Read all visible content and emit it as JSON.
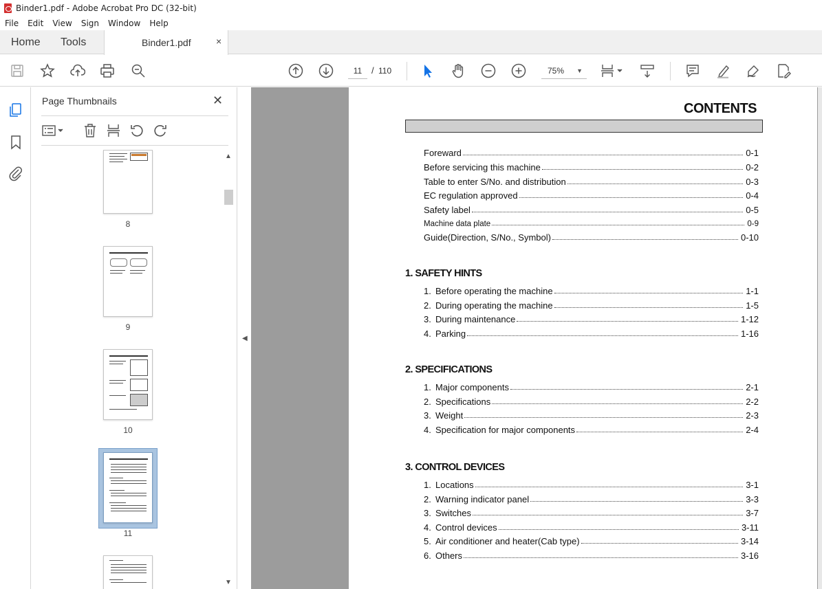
{
  "window": {
    "title": "Binder1.pdf - Adobe Acrobat Pro DC (32-bit)"
  },
  "menu": [
    "File",
    "Edit",
    "View",
    "Sign",
    "Window",
    "Help"
  ],
  "tabs": {
    "home": "Home",
    "tools": "Tools",
    "document": "Binder1.pdf",
    "close": "×"
  },
  "toolbar": {
    "current_page": "11",
    "page_separator": "/",
    "total_pages": "110",
    "zoom": "75%"
  },
  "panel": {
    "title": "Page Thumbnails",
    "thumbnails": [
      {
        "label": "8"
      },
      {
        "label": "9"
      },
      {
        "label": "10"
      },
      {
        "label": "11",
        "selected": true
      },
      {
        "label": ""
      }
    ]
  },
  "document": {
    "title": "CONTENTS",
    "front_matter": [
      {
        "text": "Foreward",
        "page": "0-1"
      },
      {
        "text": "Before servicing this machine",
        "page": "0-2"
      },
      {
        "text": "Table to enter S/No. and distribution",
        "page": "0-3"
      },
      {
        "text": "EC regulation approved",
        "page": "0-4"
      },
      {
        "text": "Safety label",
        "page": "0-5"
      },
      {
        "text": "Machine data plate",
        "page": "0-9"
      },
      {
        "text": "Guide(Direction, S/No., Symbol)",
        "page": "0-10"
      }
    ],
    "sections": [
      {
        "heading": "1. SAFETY HINTS",
        "items": [
          {
            "num": "1.",
            "text": "Before operating the machine",
            "page": "1-1"
          },
          {
            "num": "2.",
            "text": "During operating the machine",
            "page": "1-5"
          },
          {
            "num": "3.",
            "text": "During maintenance",
            "page": "1-12"
          },
          {
            "num": "4.",
            "text": "Parking",
            "page": "1-16"
          }
        ]
      },
      {
        "heading": "2. SPECIFICATIONS",
        "items": [
          {
            "num": "1.",
            "text": "Major components",
            "page": "2-1"
          },
          {
            "num": "2.",
            "text": "Specifications",
            "page": "2-2"
          },
          {
            "num": "3.",
            "text": "Weight",
            "page": "2-3"
          },
          {
            "num": "4.",
            "text": "Specification for major components",
            "page": "2-4"
          }
        ]
      },
      {
        "heading": "3. CONTROL DEVICES",
        "items": [
          {
            "num": "1.",
            "text": "Locations",
            "page": "3-1"
          },
          {
            "num": "2.",
            "text": "Warning indicator panel",
            "page": "3-3"
          },
          {
            "num": "3.",
            "text": "Switches",
            "page": "3-7"
          },
          {
            "num": "4.",
            "text": "Control devices",
            "page": "3-11"
          },
          {
            "num": "5.",
            "text": "Air conditioner and heater(Cab type)",
            "page": "3-14"
          },
          {
            "num": "6.",
            "text": "Others",
            "page": "3-16"
          }
        ]
      }
    ]
  },
  "colors": {
    "accent": "#1473e6",
    "viewer_bg": "#9c9c9c",
    "tab_bg": "#f0f0f0",
    "pdf_icon": "#d32f2f"
  }
}
